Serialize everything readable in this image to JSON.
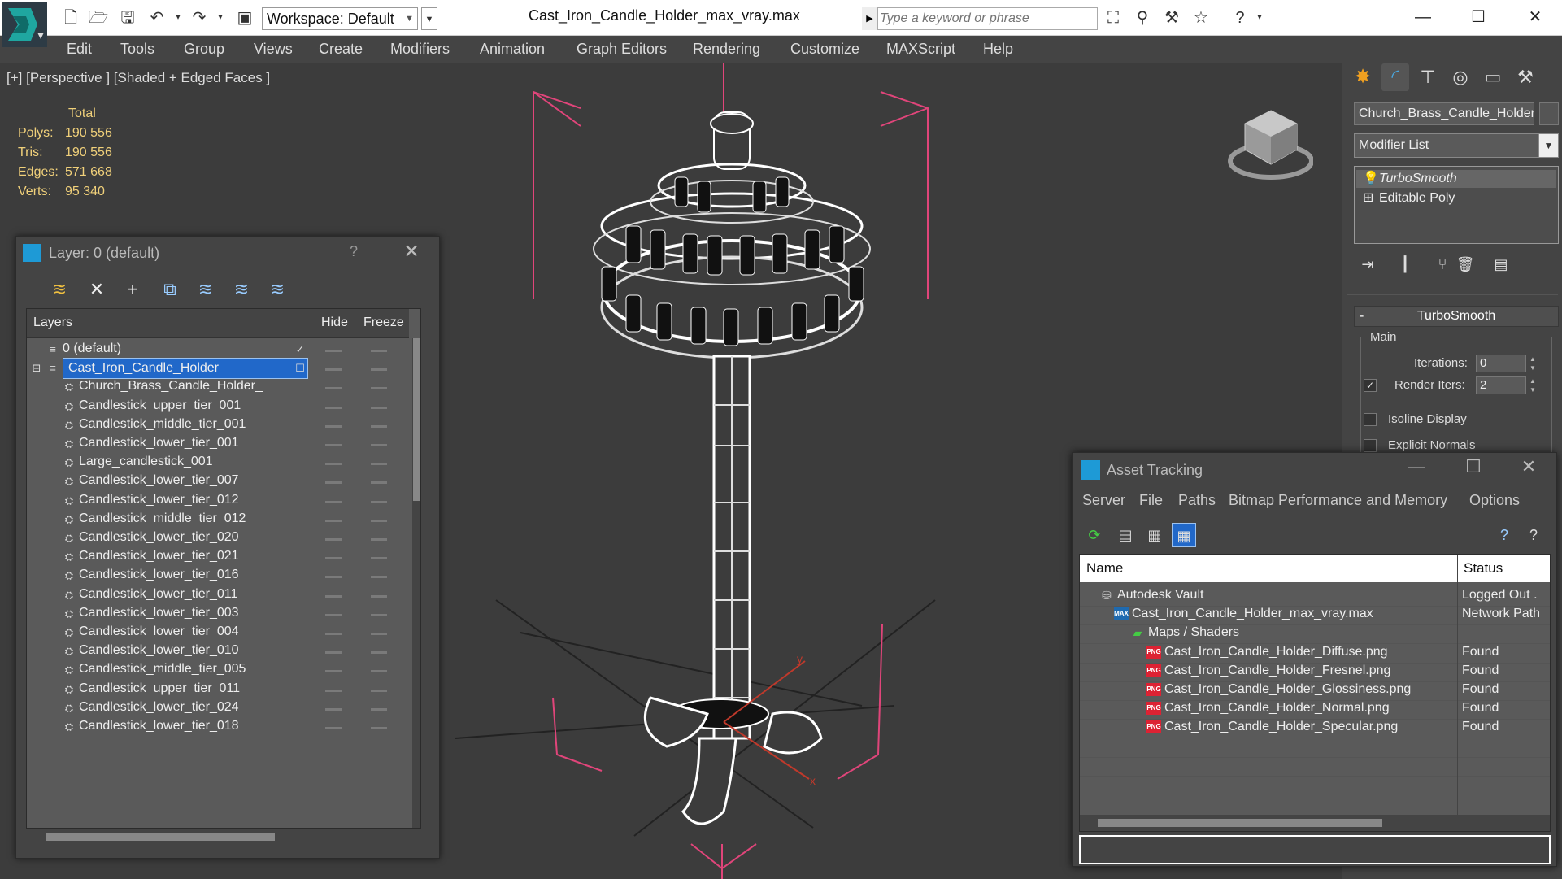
{
  "title_bar": {
    "workspace_label": "Workspace: Default",
    "document_title": "Cast_Iron_Candle_Holder_max_vray.max",
    "search_placeholder": "Type a keyword or phrase"
  },
  "menu": [
    "Edit",
    "Tools",
    "Group",
    "Views",
    "Create",
    "Modifiers",
    "Animation",
    "Graph Editors",
    "Rendering",
    "Customize",
    "MAXScript",
    "Help"
  ],
  "viewport": {
    "label": "[+] [Perspective ] [Shaded + Edged Faces ]",
    "stats_header": "Total",
    "stats": [
      {
        "key": "Polys:",
        "value": "190 556"
      },
      {
        "key": "Tris:",
        "value": "190 556"
      },
      {
        "key": "Edges:",
        "value": "571 668"
      },
      {
        "key": "Verts:",
        "value": "95 340"
      }
    ],
    "axis_x": "x",
    "axis_y": "y"
  },
  "command_panel": {
    "object_name": "Church_Brass_Candle_Holder_",
    "modifier_list": "Modifier List",
    "stack": [
      "TurboSmooth",
      "Editable Poly"
    ],
    "rollout_title": "TurboSmooth",
    "rollout_sign": "-",
    "group_main": "Main",
    "iterations_label": "Iterations:",
    "iterations_value": "0",
    "render_iters_label": "Render Iters:",
    "render_iters_value": "2",
    "isoline_label": "Isoline Display",
    "explicit_normals_label": "Explicit Normals"
  },
  "layer_dialog": {
    "title": "Layer: 0 (default)",
    "help": "?",
    "columns": {
      "layers": "Layers",
      "hide": "Hide",
      "freeze": "Freeze"
    },
    "rows": [
      "0 (default)",
      "Cast_Iron_Candle_Holder",
      "Church_Brass_Candle_Holder_",
      "Candlestick_upper_tier_001",
      "Candlestick_middle_tier_001",
      "Candlestick_lower_tier_001",
      "Large_candlestick_001",
      "Candlestick_lower_tier_007",
      "Candlestick_lower_tier_012",
      "Candlestick_middle_tier_012",
      "Candlestick_lower_tier_020",
      "Candlestick_lower_tier_021",
      "Candlestick_lower_tier_016",
      "Candlestick_lower_tier_011",
      "Candlestick_lower_tier_003",
      "Candlestick_lower_tier_004",
      "Candlestick_lower_tier_010",
      "Candlestick_middle_tier_005",
      "Candlestick_upper_tier_011",
      "Candlestick_lower_tier_024",
      "Candlestick_lower_tier_018"
    ]
  },
  "asset_dialog": {
    "title": "Asset Tracking",
    "menu": [
      "Server",
      "File",
      "Paths",
      "Bitmap Performance and Memory",
      "Options"
    ],
    "columns": {
      "name": "Name",
      "status": "Status"
    },
    "rows": [
      {
        "name": "Autodesk Vault",
        "status": "Logged Out ."
      },
      {
        "name": "Cast_Iron_Candle_Holder_max_vray.max",
        "status": "Network Path"
      },
      {
        "name": "Maps / Shaders",
        "status": ""
      },
      {
        "name": "Cast_Iron_Candle_Holder_Diffuse.png",
        "status": "Found"
      },
      {
        "name": "Cast_Iron_Candle_Holder_Fresnel.png",
        "status": "Found"
      },
      {
        "name": "Cast_Iron_Candle_Holder_Glossiness.png",
        "status": "Found"
      },
      {
        "name": "Cast_Iron_Candle_Holder_Normal.png",
        "status": "Found"
      },
      {
        "name": "Cast_Iron_Candle_Holder_Specular.png",
        "status": "Found"
      }
    ],
    "png_badge": "PNG",
    "max_badge": "MAX"
  },
  "colors": {
    "selection": "#2168c9",
    "stats": "#f0d07a",
    "bbox": "#e0457a",
    "accent": "#1e9ad6"
  }
}
